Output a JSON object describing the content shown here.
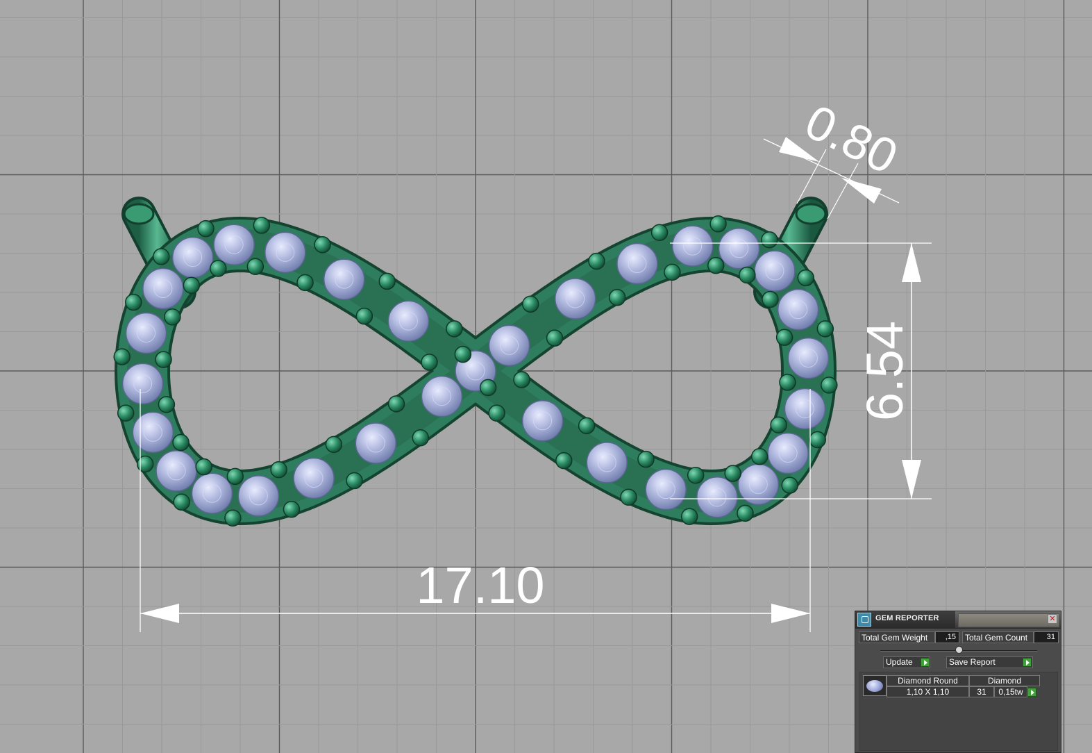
{
  "viewport": {
    "background_color": "#a8a8a8",
    "grid_color": "#999999",
    "axis_color": "#5a5a5a",
    "metal_color": "#2e7d5e",
    "stone_color": "#aab2d8",
    "dimension_color": "#ffffff"
  },
  "dimensions": {
    "width": "17.10",
    "height": "6.54",
    "thickness": "0.80"
  },
  "gem_reporter": {
    "title": "GEM REPORTER",
    "close_icon": "close-icon",
    "total_weight_label": "Total Gem Weight",
    "total_weight_value": ",15",
    "total_count_label": "Total Gem Count",
    "total_count_value": "31",
    "update_label": "Update",
    "save_report_label": "Save Report",
    "rows": [
      {
        "shape": "Diamond Round",
        "material": "Diamond",
        "size": "1,10 X 1,10",
        "count": "31",
        "weight": "0,15tw"
      }
    ]
  }
}
